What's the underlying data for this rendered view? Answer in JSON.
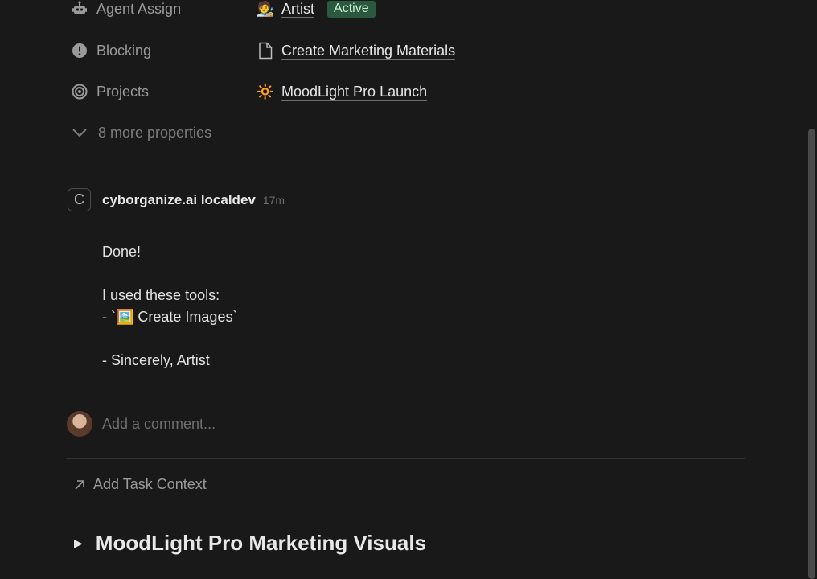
{
  "properties": [
    {
      "label": "Agent Assign",
      "icon": "robot-icon",
      "value": "Artist",
      "value_icon": "🧑‍🎨",
      "badge": "Active"
    },
    {
      "label": "Blocking",
      "icon": "alert-icon",
      "value": "Create Marketing Materials",
      "value_icon": "page-icon"
    },
    {
      "label": "Projects",
      "icon": "target-icon",
      "value": "MoodLight Pro Launch",
      "value_icon": "🔆"
    }
  ],
  "more_properties": "8 more properties",
  "comment": {
    "avatar_letter": "C",
    "author": "cyborganize.ai localdev",
    "time": "17m",
    "lines": [
      "Done!",
      "",
      "I used these tools:",
      "- `🖼️ Create Images`",
      "",
      "- Sincerely, Artist"
    ]
  },
  "add_comment_placeholder": "Add a comment...",
  "add_task_context": "Add Task Context",
  "heading": "MoodLight Pro Marketing Visuals",
  "colors": {
    "background": "#191919",
    "badge_bg": "#2b593f",
    "badge_text": "#c7eed3"
  }
}
